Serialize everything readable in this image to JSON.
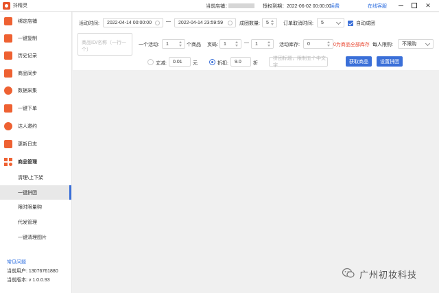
{
  "titlebar": {
    "app_title": "抖精灵",
    "store_label": "当前店铺：",
    "expire_label": "授权到期：2022-06-02 00:00:00",
    "renew": "续费",
    "service": "在线客服"
  },
  "sidebar": {
    "items": [
      {
        "label": "绑定店铺"
      },
      {
        "label": "一键复制"
      },
      {
        "label": "历史记录"
      },
      {
        "label": "商品同步"
      },
      {
        "label": "数据采集"
      },
      {
        "label": "一键下单"
      },
      {
        "label": "达人邀约"
      },
      {
        "label": "更新日志"
      },
      {
        "label": "商品管理"
      }
    ],
    "sub_items": [
      {
        "label": "清理\\上下架"
      },
      {
        "label": "一键拼团"
      },
      {
        "label": "限时限量购"
      },
      {
        "label": "代发管理"
      },
      {
        "label": "一键清理图片"
      }
    ],
    "faq": "常见问题",
    "user": "当前用户: 13076761880",
    "version": "当前版本: v 1.0.0.93"
  },
  "form": {
    "activity_time_label": "活动时间:",
    "start_time": "2022-04-14 00:00:00",
    "dash": "—",
    "end_time": "2022-04-14 23:59:59",
    "group_count_label": "成团数量:",
    "group_count": "5",
    "cancel_time_label": "订单取消时间:",
    "cancel_time": "5",
    "auto_group_label": "自动成团",
    "product_ids_placeholder": "商品ID/名称（一行一个）",
    "one_activity_label": "一个活动:",
    "one_activity_value": "1",
    "product_unit": "个商品",
    "page_label": "页码:",
    "page_from": "1",
    "page_dash": "—",
    "page_to": "1",
    "stock_label": "活动库存:",
    "stock_value": "0",
    "stock_warning": "0为商品全部库存",
    "limit_label": "每人限购:",
    "limit_value": "不限购",
    "reduce_label": "立减:",
    "reduce_value": "0.01",
    "reduce_unit": "元",
    "discount_label": "折扣:",
    "discount_value": "9.0",
    "discount_unit": "折",
    "title_placeholder": "拼团标题，限制五个中文字",
    "get_products_btn": "获取商品",
    "set_group_btn": "设置拼团"
  },
  "watermark": {
    "text": "广州初妆科技"
  }
}
